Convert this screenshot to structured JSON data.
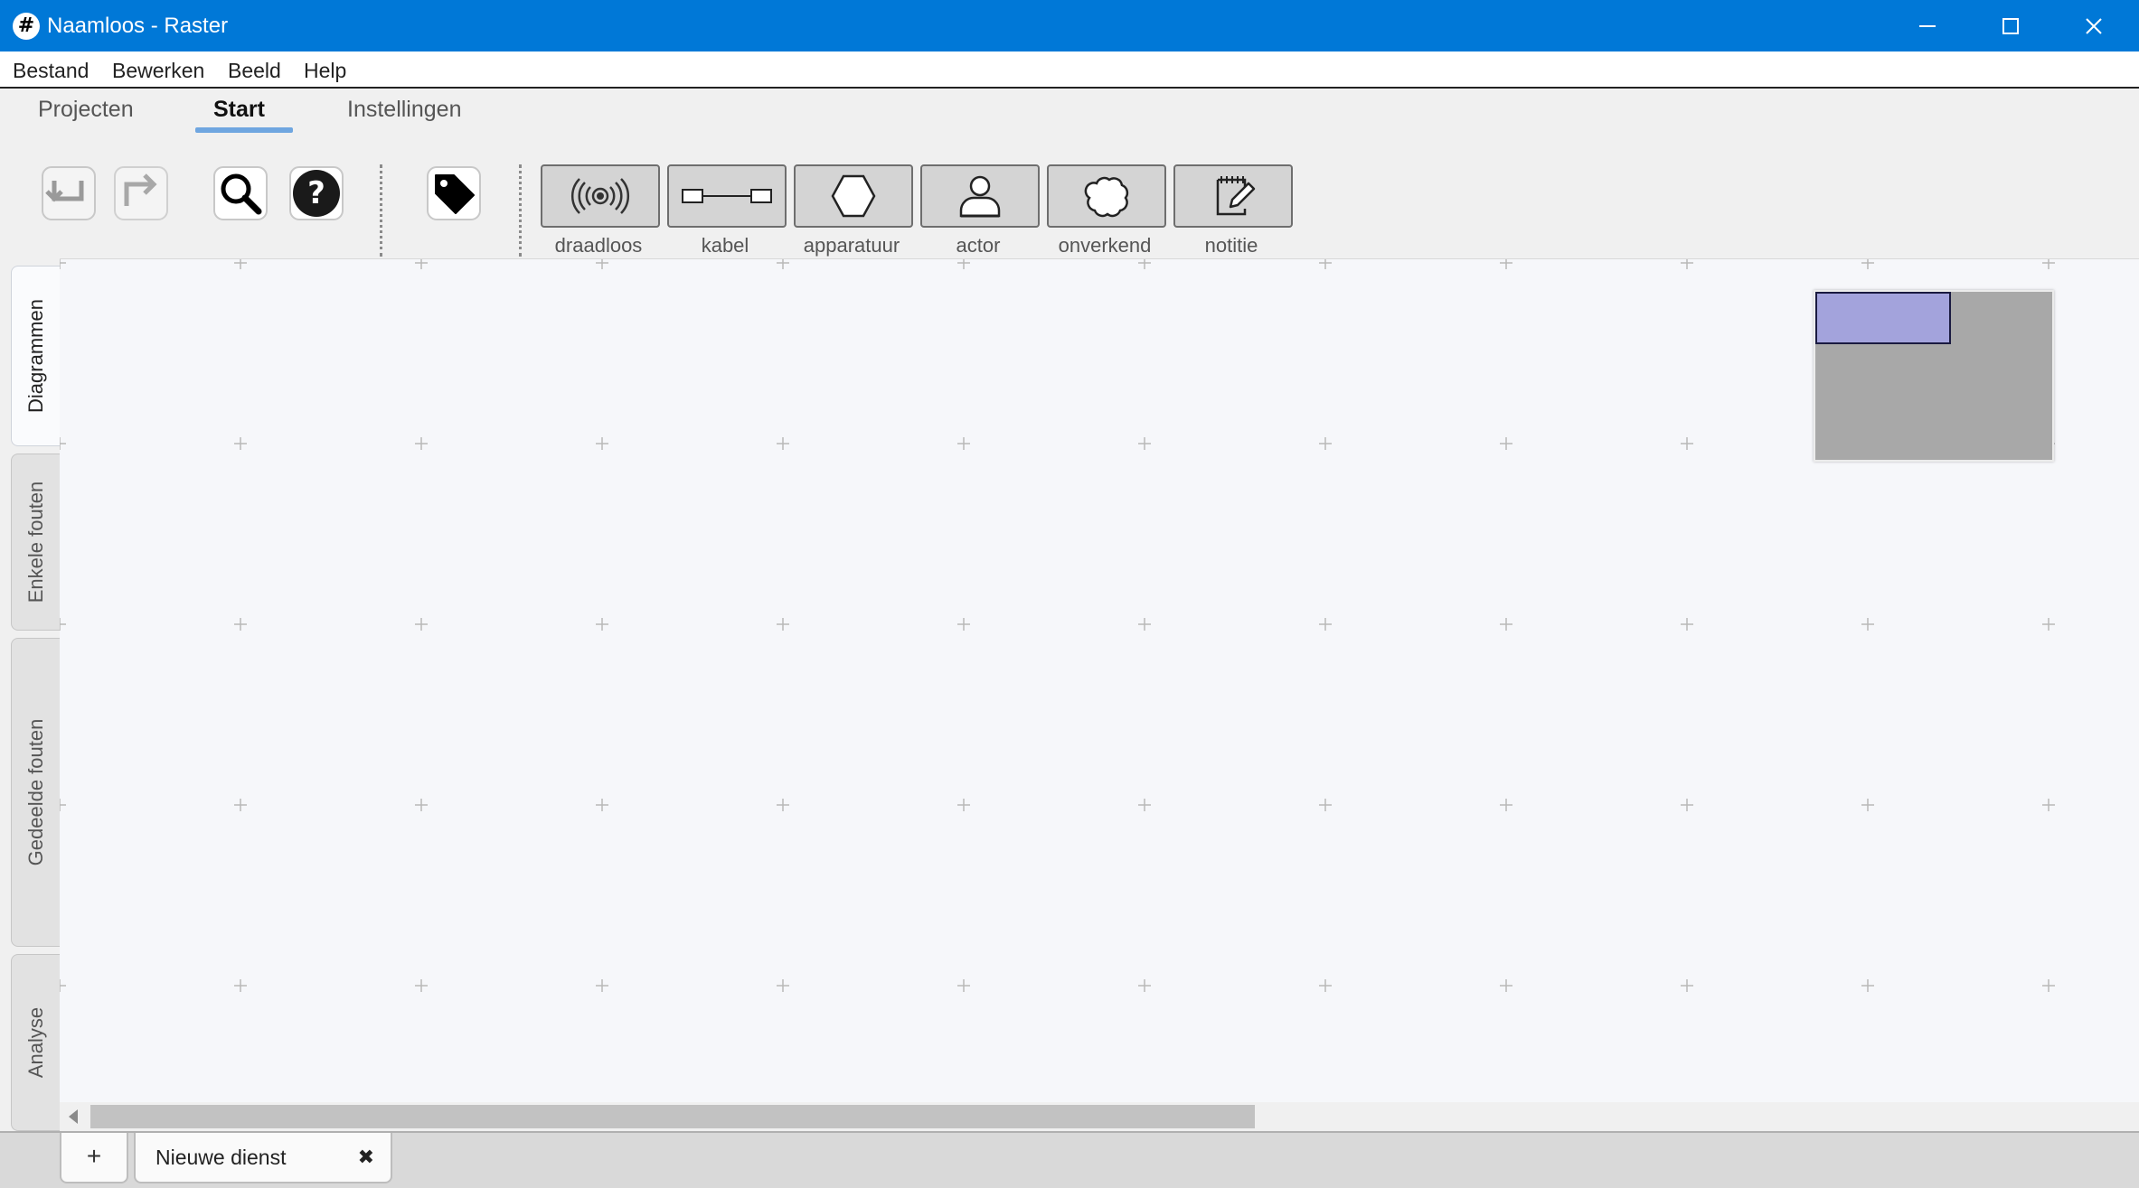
{
  "window": {
    "app_icon": "#",
    "title": "Naamloos - Raster",
    "controls": [
      "minimize-icon",
      "maximize-icon",
      "close-icon"
    ]
  },
  "menu": {
    "items": [
      "Bestand",
      "Bewerken",
      "Beeld",
      "Help"
    ]
  },
  "ribbon": {
    "tabs": [
      "Projecten",
      "Start",
      "Instellingen"
    ],
    "active_tab": "Start"
  },
  "toolbar": {
    "tools": [
      {
        "name": "undo",
        "icon": "undo-icon",
        "enabled": true
      },
      {
        "name": "redo",
        "icon": "redo-icon",
        "enabled": false
      },
      {
        "name": "search",
        "icon": "search-icon",
        "enabled": true
      },
      {
        "name": "help",
        "icon": "help-icon",
        "enabled": true
      },
      {
        "name": "label",
        "icon": "tag-icon",
        "enabled": true
      }
    ],
    "shapes": [
      {
        "label": "draadloos",
        "icon": "wireless-icon"
      },
      {
        "label": "kabel",
        "icon": "cable-icon"
      },
      {
        "label": "apparatuur",
        "icon": "hexagon-icon"
      },
      {
        "label": "actor",
        "icon": "person-icon"
      },
      {
        "label": "onverkend",
        "icon": "cloud-icon"
      },
      {
        "label": "notitie",
        "icon": "note-icon"
      }
    ]
  },
  "side_tabs": [
    {
      "label": "Diagrammen",
      "active": true
    },
    {
      "label": "Enkele fouten",
      "active": false
    },
    {
      "label": "Gedeelde fouten",
      "active": false
    },
    {
      "label": "Analyse",
      "active": false
    }
  ],
  "canvas": {
    "background": "#f6f7fa",
    "grid_marker": "+",
    "minimap": {
      "background": "#a8a8a8",
      "viewport_color": "#a3a3dc"
    }
  },
  "scrollbar": {
    "thumb_fraction": 0.57
  },
  "bottom_tabs": {
    "add_label": "+",
    "documents": [
      {
        "label": "Nieuwe dienst",
        "close_glyph": "✖"
      }
    ]
  },
  "colors": {
    "titlebar": "#0078d7",
    "tab_underline": "#6fa6e0"
  }
}
